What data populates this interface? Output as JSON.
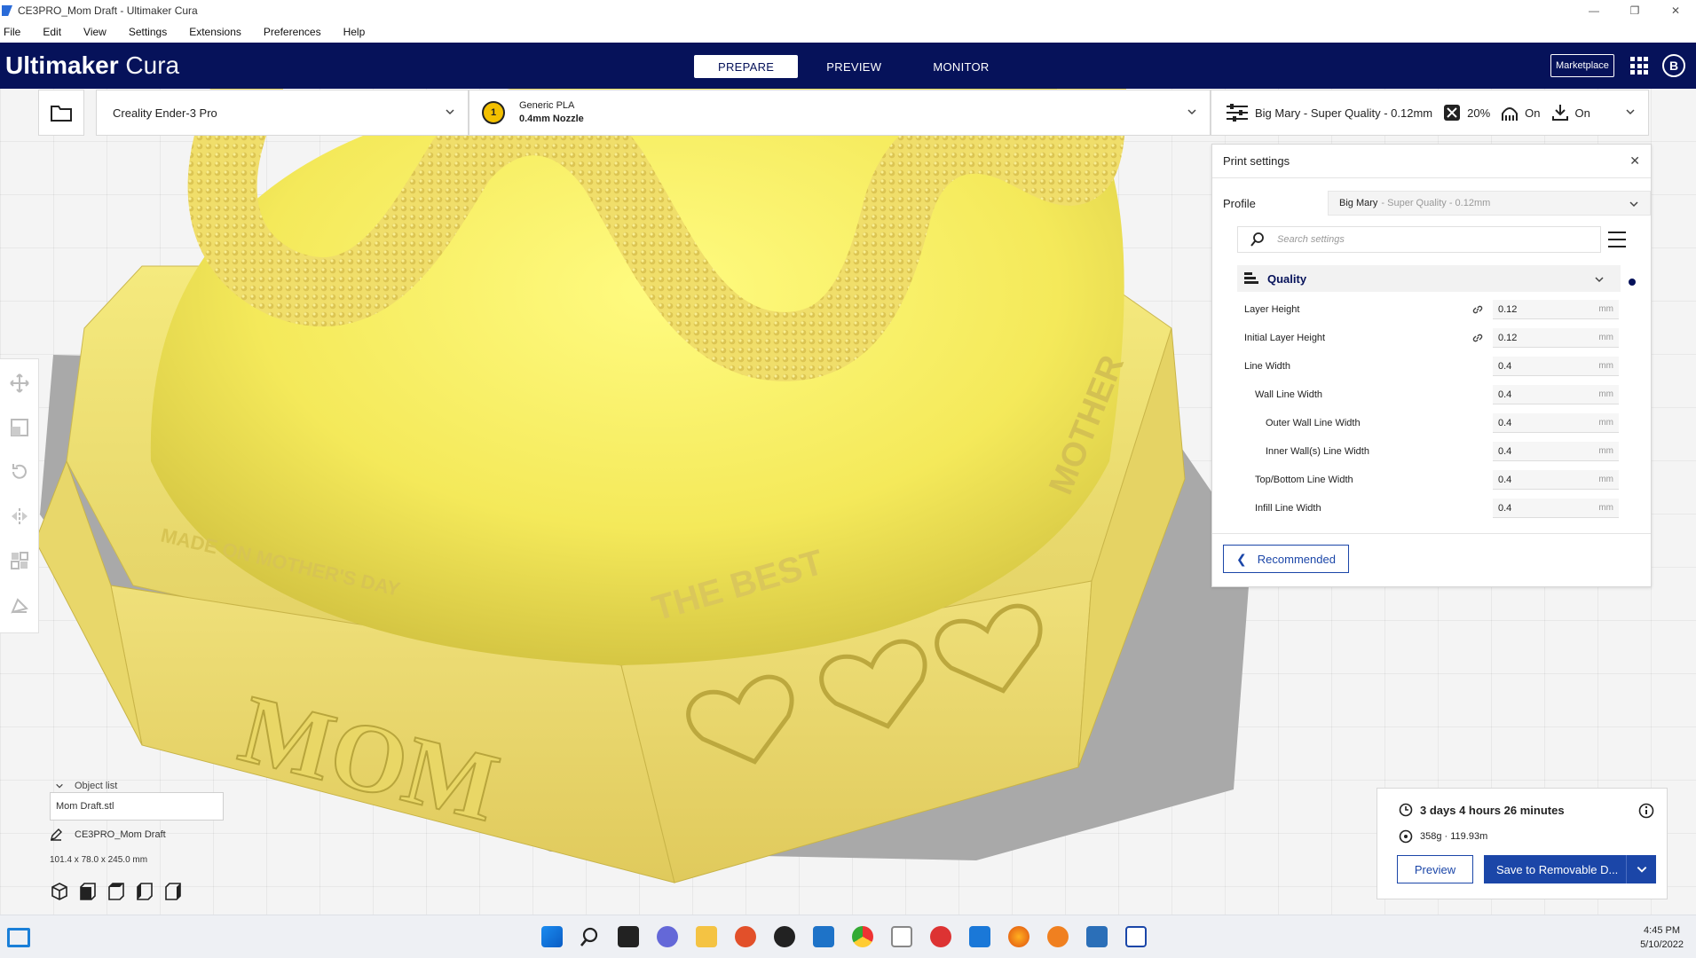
{
  "window": {
    "title": "CE3PRO_Mom Draft - Ultimaker Cura"
  },
  "menu": {
    "items": [
      "File",
      "Edit",
      "View",
      "Settings",
      "Extensions",
      "Preferences",
      "Help"
    ]
  },
  "header": {
    "brand_bold": "Ultimaker",
    "brand_light": "Cura",
    "tabs": [
      {
        "label": "PREPARE",
        "active": true
      },
      {
        "label": "PREVIEW",
        "active": false
      },
      {
        "label": "MONITOR",
        "active": false
      }
    ],
    "marketplace_label": "Marketplace",
    "avatar_letter": "B"
  },
  "toolbar": {
    "machine": "Creality Ender-3 Pro",
    "extruder_number": "1",
    "material": "Generic PLA",
    "nozzle": "0.4mm Nozzle",
    "profile_summary": "Big Mary - Super Quality - 0.12mm",
    "infill": "20%",
    "support": "On",
    "adhesion": "On"
  },
  "print_settings": {
    "title": "Print settings",
    "profile_label": "Profile",
    "profile_name": "Big Mary",
    "profile_sub": " - Super Quality - 0.12mm",
    "search_placeholder": "Search settings",
    "category": "Quality",
    "rows": [
      {
        "label": "Layer Height",
        "value": "0.12",
        "unit": "mm",
        "indent": 0,
        "linked": true
      },
      {
        "label": "Initial Layer Height",
        "value": "0.12",
        "unit": "mm",
        "indent": 0,
        "linked": true
      },
      {
        "label": "Line Width",
        "value": "0.4",
        "unit": "mm",
        "indent": 0,
        "linked": false
      },
      {
        "label": "Wall Line Width",
        "value": "0.4",
        "unit": "mm",
        "indent": 1,
        "linked": false
      },
      {
        "label": "Outer Wall Line Width",
        "value": "0.4",
        "unit": "mm",
        "indent": 2,
        "linked": false
      },
      {
        "label": "Inner Wall(s) Line Width",
        "value": "0.4",
        "unit": "mm",
        "indent": 2,
        "linked": false
      },
      {
        "label": "Top/Bottom Line Width",
        "value": "0.4",
        "unit": "mm",
        "indent": 1,
        "linked": false
      },
      {
        "label": "Infill Line Width",
        "value": "0.4",
        "unit": "mm",
        "indent": 1,
        "linked": false
      }
    ],
    "recommended_label": "Recommended"
  },
  "object_list": {
    "header": "Object list",
    "item": "Mom Draft.stl",
    "job_name": "CE3PRO_Mom Draft",
    "dimensions": "101.4 x 78.0 x 245.0 mm"
  },
  "job": {
    "time": "3 days 4 hours 26 minutes",
    "material": "358g · 119.93m",
    "preview_label": "Preview",
    "save_label": "Save to Removable D..."
  },
  "model": {
    "front_text": "MOM",
    "rim_text": "MADE ON MOTHER'S DAY",
    "best_text": "THE BEST",
    "side_text": "MOTHER",
    "color": "#f1e066"
  },
  "taskbar": {
    "time": "4:45 PM",
    "date": "5/10/2022"
  }
}
